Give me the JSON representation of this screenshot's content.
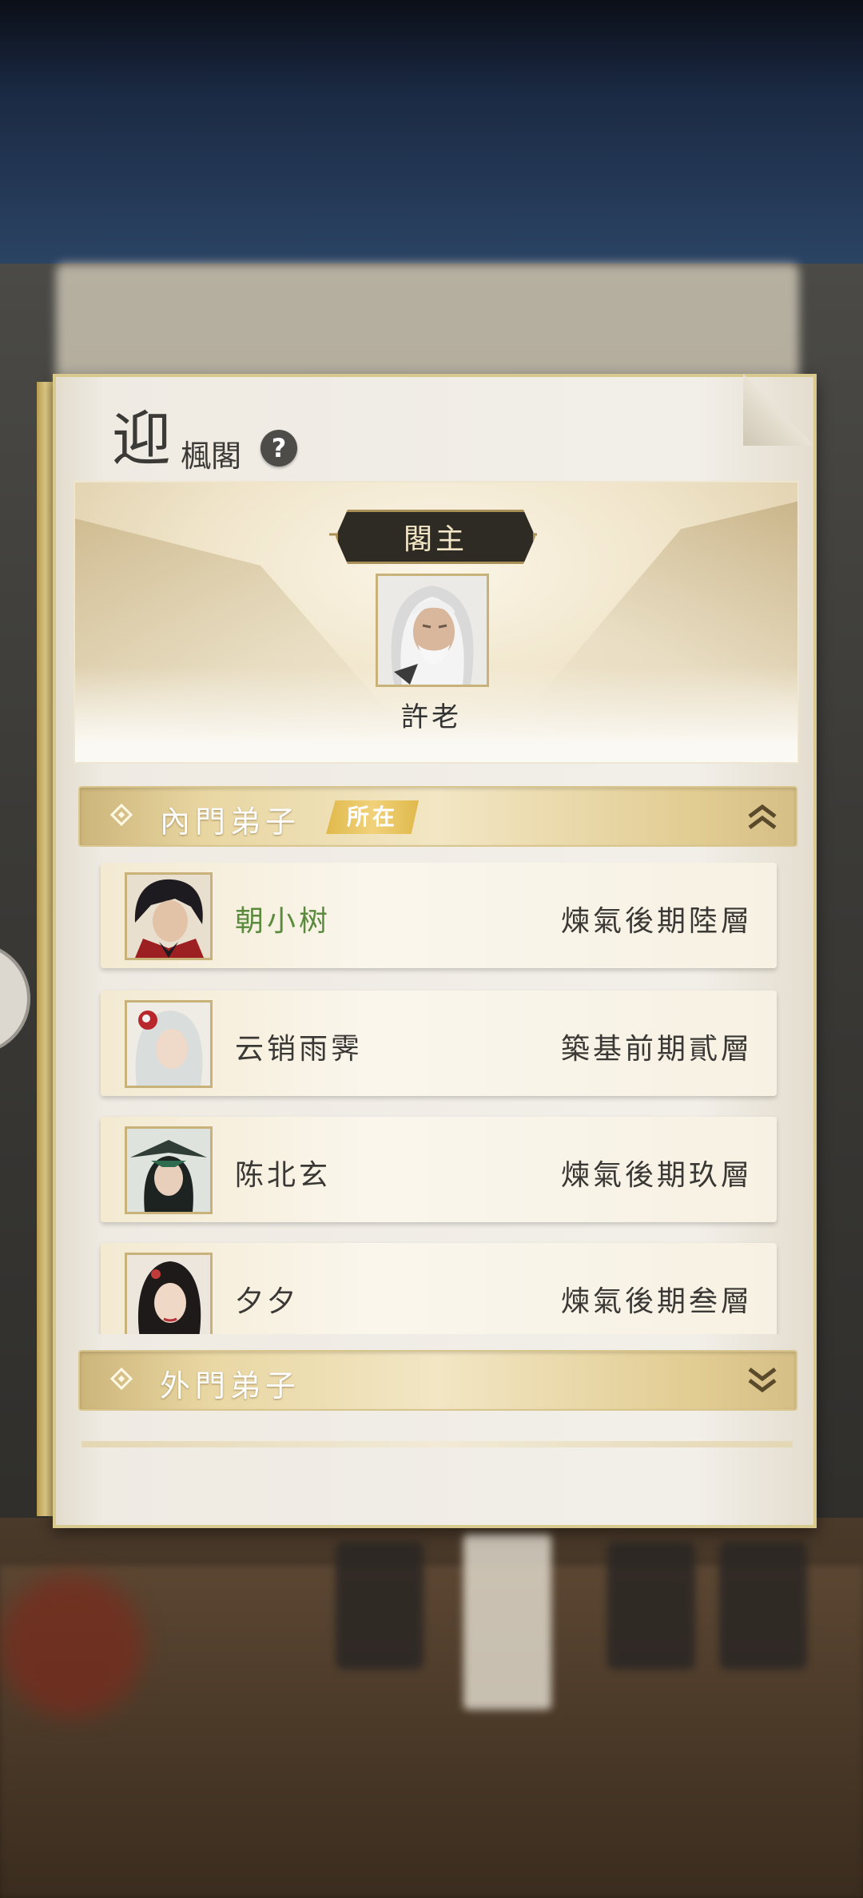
{
  "panel": {
    "logo_big": "迎",
    "logo_small": "楓閣",
    "help_label": "?"
  },
  "leader": {
    "title": "閣主",
    "name": "許老"
  },
  "inner_section": {
    "label": "內門弟子",
    "tag": "所在",
    "chevron": "chevron-up-double-icon",
    "members": [
      {
        "name": "朝小树",
        "rank": "煉氣後期陸層",
        "is_self": true
      },
      {
        "name": "云销雨霁",
        "rank": "築基前期貳層",
        "is_self": false
      },
      {
        "name": "陈北玄",
        "rank": "煉氣後期玖層",
        "is_self": false
      },
      {
        "name": "夕夕",
        "rank": "煉氣後期叁層",
        "is_self": false
      }
    ]
  },
  "outer_section": {
    "label": "外門弟子",
    "chevron": "chevron-down-double-icon"
  },
  "colors": {
    "self_name": "#5a8a3c",
    "gold_accent": "#d9c58e",
    "plate_bg": "#2e2a24"
  }
}
